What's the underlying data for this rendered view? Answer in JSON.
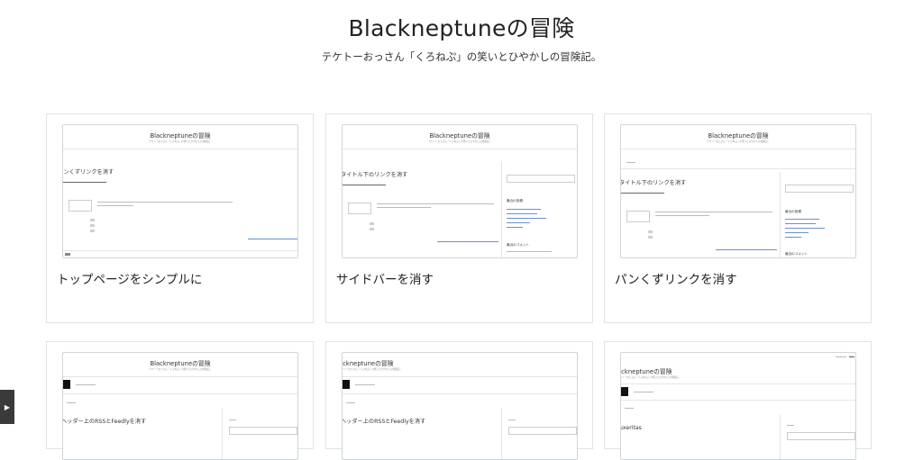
{
  "header": {
    "title": "Blackneptuneの冒険",
    "description": "テケトーおっさん「くろねぷ」の笑いとひやかしの冒険記。"
  },
  "posts": [
    {
      "title": "トップページをシンプルに",
      "thumb": {
        "site_title": "Blackneptuneの冒険",
        "post_title": "パンくずリンクを消す",
        "sidebar": false
      }
    },
    {
      "title": "サイドバーを消す",
      "thumb": {
        "site_title": "Blackneptuneの冒険",
        "post_title": "タイトル下のリンクを消す",
        "sidebar": true,
        "side_heading": "最近の投稿",
        "side_heading2": "最近のコメント"
      }
    },
    {
      "title": "パンくずリンクを消す",
      "thumb": {
        "site_title": "Blackneptuneの冒険",
        "post_title": "タイトル下のリンクを消す",
        "sidebar": true,
        "side_heading": "最近の投稿",
        "side_heading2": "最近のコメント"
      }
    },
    {
      "title": "",
      "thumb": {
        "site_title": "Blackneptuneの冒険",
        "post_title": "ヘッダー上のRSSとFeedlyを消す",
        "sidebar": true
      }
    },
    {
      "title": "",
      "thumb": {
        "site_title": "ackneptuneの冒険",
        "post_title": "ヘッダー上のRSSとFeedlyを消す",
        "sidebar": true
      }
    },
    {
      "title": "",
      "thumb": {
        "site_title": "ackneptuneの冒険",
        "post_title": "uxeritas",
        "sidebar": true
      }
    }
  ],
  "sidebar_toggle": {
    "icon": "play-icon",
    "glyph": "▶"
  }
}
